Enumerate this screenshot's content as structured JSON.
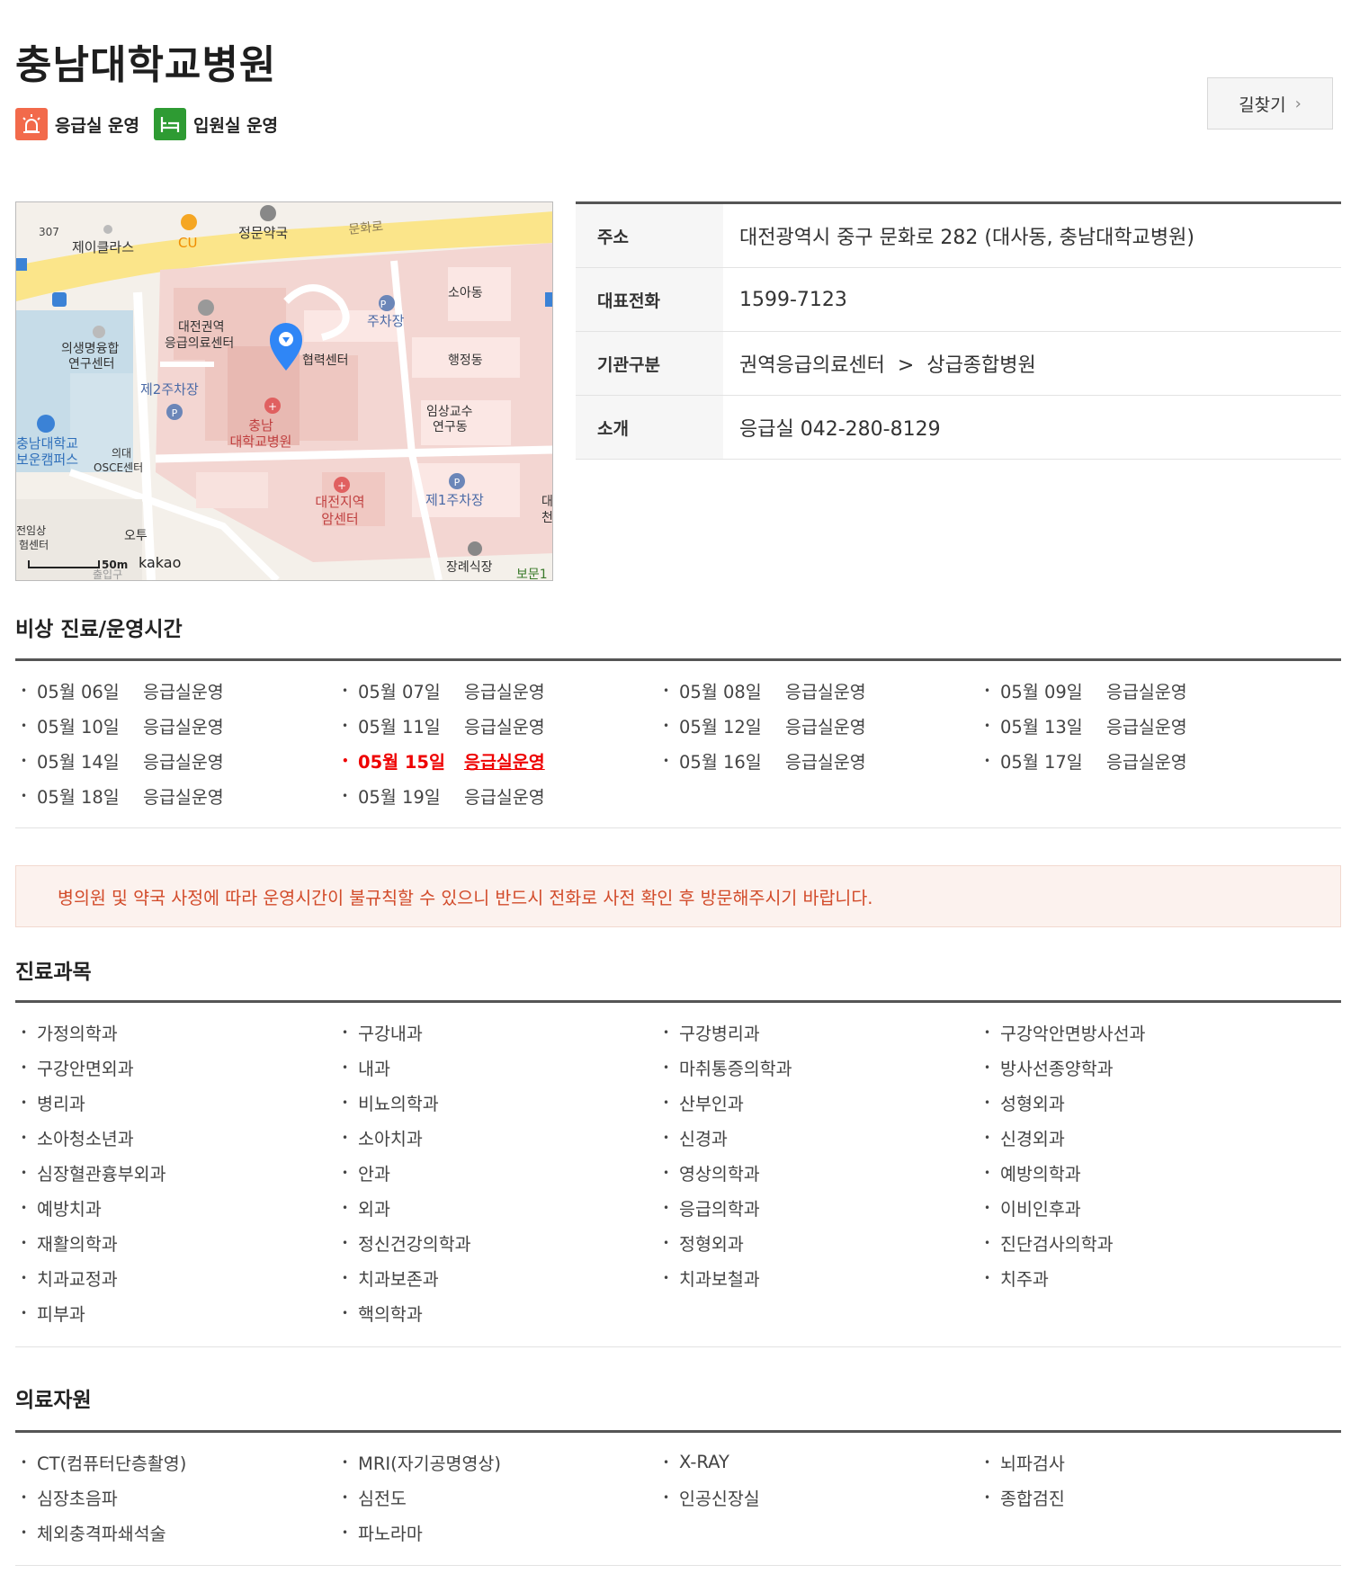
{
  "hospital": {
    "name": "충남대학교병원",
    "badges": [
      {
        "icon": "siren-icon",
        "label": "응급실 운영",
        "color": "#f26a4b"
      },
      {
        "icon": "bed-icon",
        "label": "입원실 운영",
        "color": "#2e9b33"
      }
    ],
    "route_button": "길찾기"
  },
  "map": {
    "scale": "50m",
    "brand": "kakao",
    "labels": {
      "road307": "307",
      "jclass": "제이클라스",
      "cu": "CU",
      "pharmacy": "정문약국",
      "munhwa_ro": "문화로",
      "soa": "소아동",
      "parking": "주차장",
      "emergency_center_1": "대전권역",
      "emergency_center_2": "응급의료센터",
      "biomed_1": "의생명융합",
      "biomed_2": "연구센터",
      "cooperation": "협력센터",
      "admin": "행정동",
      "parking2": "제2주차장",
      "hospital_1": "충남",
      "hospital_2": "대학교병원",
      "clinical_1": "임상교수",
      "clinical_2": "연구동",
      "campus_1": "충남대학교",
      "campus_2": "보운캠퍼스",
      "osce_1": "의대",
      "osce_2": "OSCE센터",
      "cancer_1": "대전지역",
      "cancer_2": "암센터",
      "parking1": "제1주차장",
      "edge_1": "대",
      "edge_2": "천",
      "trial_1": "전임상",
      "trial_2": "험센터",
      "otu": "오투",
      "gate": "출입구",
      "funeral": "장례식장",
      "bomun": "보문1"
    }
  },
  "info": {
    "rows": [
      {
        "key": "주소",
        "value": "대전광역시 중구 문화로 282 (대사동, 충남대학교병원)"
      },
      {
        "key": "대표전화",
        "value": "1599-7123"
      },
      {
        "key": "기관구분",
        "value": "권역응급의료센터  >  상급종합병원"
      },
      {
        "key": "소개",
        "value": "응급실 042-280-8129"
      }
    ]
  },
  "schedule": {
    "title": "비상 진료/운영시간",
    "items": [
      {
        "date": "05월 06일",
        "status": "응급실운영"
      },
      {
        "date": "05월 07일",
        "status": "응급실운영"
      },
      {
        "date": "05월 08일",
        "status": "응급실운영"
      },
      {
        "date": "05월 09일",
        "status": "응급실운영"
      },
      {
        "date": "05월 10일",
        "status": "응급실운영"
      },
      {
        "date": "05월 11일",
        "status": "응급실운영"
      },
      {
        "date": "05월 12일",
        "status": "응급실운영"
      },
      {
        "date": "05월 13일",
        "status": "응급실운영"
      },
      {
        "date": "05월 14일",
        "status": "응급실운영"
      },
      {
        "date": "05월 15일",
        "status": "응급실운영"
      },
      {
        "date": "05월 16일",
        "status": "응급실운영"
      },
      {
        "date": "05월 17일",
        "status": "응급실운영"
      },
      {
        "date": "05월 18일",
        "status": "응급실운영"
      },
      {
        "date": "05월 19일",
        "status": "응급실운영"
      }
    ],
    "highlight_color": "#e00000"
  },
  "notice": "병의원 및 약국 사정에 따라 운영시간이 불규칙할 수 있으니 반드시 전화로 사전 확인 후 방문해주시기 바랍니다.",
  "departments": {
    "title": "진료과목",
    "items": [
      "가정의학과",
      "구강내과",
      "구강병리과",
      "구강악안면방사선과",
      "구강안면외과",
      "내과",
      "마취통증의학과",
      "방사선종양학과",
      "병리과",
      "비뇨의학과",
      "산부인과",
      "성형외과",
      "소아청소년과",
      "소아치과",
      "신경과",
      "신경외과",
      "심장혈관흉부외과",
      "안과",
      "영상의학과",
      "예방의학과",
      "예방치과",
      "외과",
      "응급의학과",
      "이비인후과",
      "재활의학과",
      "정신건강의학과",
      "정형외과",
      "진단검사의학과",
      "치과교정과",
      "치과보존과",
      "치과보철과",
      "치주과",
      "피부과",
      "핵의학과"
    ]
  },
  "resources": {
    "title": "의료자원",
    "items": [
      "CT(컴퓨터단층촬영)",
      "MRI(자기공명영상)",
      "X-RAY",
      "뇌파검사",
      "심장초음파",
      "심전도",
      "인공신장실",
      "종합검진",
      "체외충격파쇄석술",
      "파노라마"
    ]
  }
}
